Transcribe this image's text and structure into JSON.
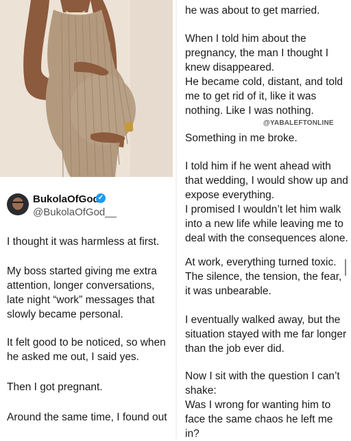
{
  "profile": {
    "display_name": "BukolaOfGod",
    "handle": "@BukolaOfGod__",
    "verified_mark": "✓"
  },
  "watermark": "@YABALEFTONLINE",
  "left_paragraphs": [
    "I thought it was harmless at first.",
    "My boss started giving me extra attention, longer conversations, late night “work” messages that slowly became personal.",
    "It felt good to be noticed, so when he asked me out, I said yes.",
    "Then I got pregnant.",
    "Around the same time, I found out"
  ],
  "right_paragraphs": [
    "he was about to get married.",
    "When I told him about the pregnancy, the man I thought I knew disappeared.\nHe became cold, distant, and told me to get rid of it, like it was nothing. Like I was nothing.",
    "Something in me broke.",
    "I told him if he went ahead with that wedding, I would show up and expose everything.\nI promised I wouldn’t let him walk into a new life while leaving me to deal with the consequences alone.",
    "At work, everything turned toxic. The silence, the tension, the fear, it was unbearable.",
    "I eventually walked away, but the situation stayed with me far longer than the job ever did.",
    "Now I sit with the question I can’t shake:\nWas I wrong for wanting him to face the same chaos he left me in?"
  ],
  "colors": {
    "verified": "#1d9bf0",
    "photo_bg": "#ebe1d5",
    "dress": "#b39a7f"
  }
}
